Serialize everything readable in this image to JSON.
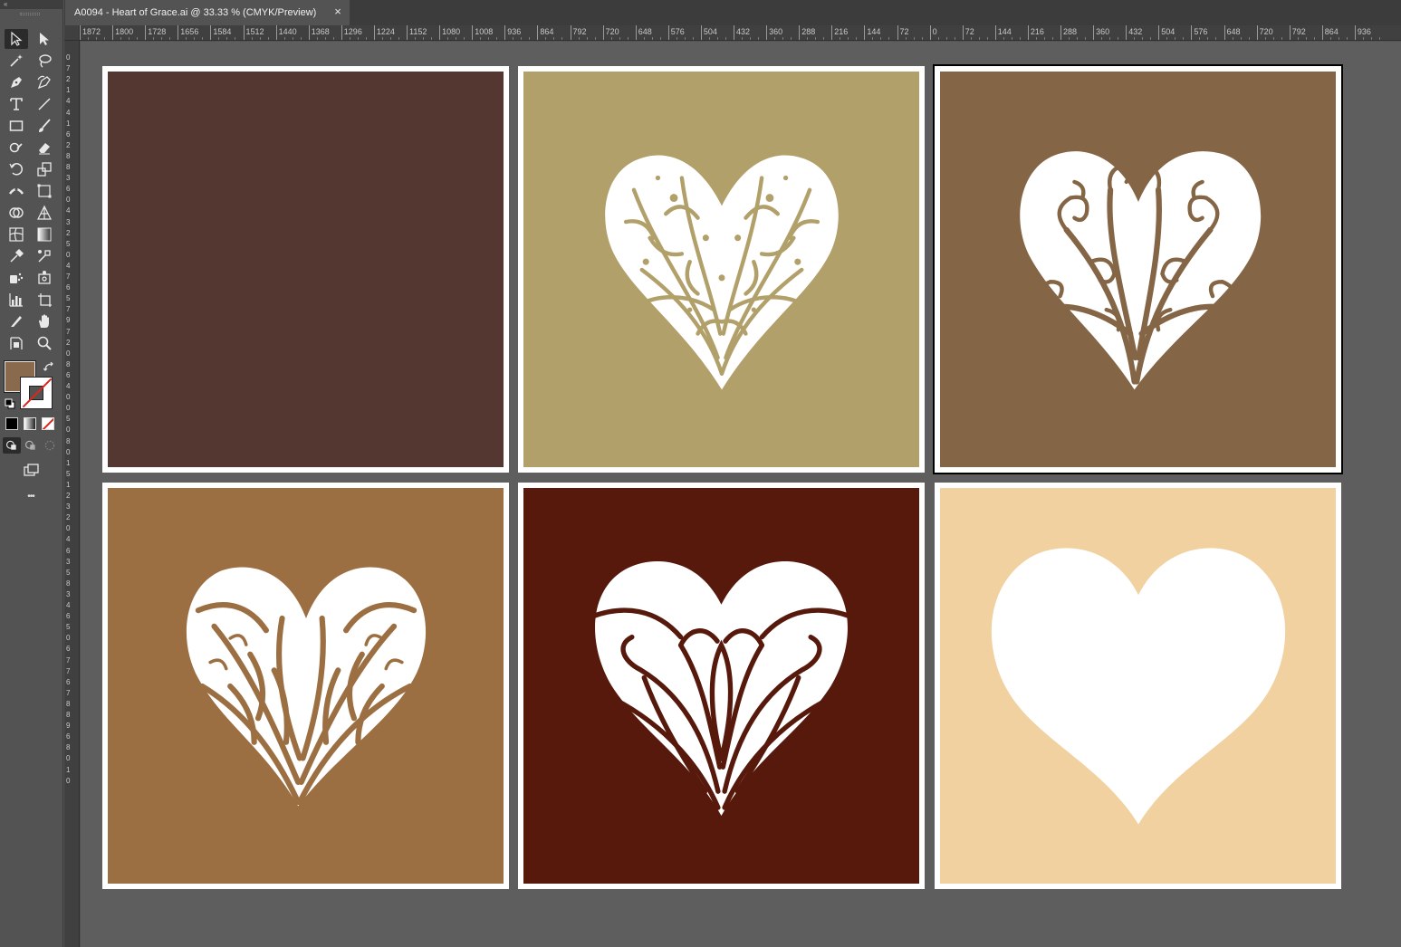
{
  "document_tab": {
    "title": "A0094 - Heart of Grace.ai @ 33.33 % (CMYK/Preview)",
    "close_glyph": "×"
  },
  "toolbar": {
    "collapse_glyph": "«",
    "more_glyph": "•••",
    "fill_color": "#8a6a4c",
    "stroke_color": "none",
    "tools": [
      "selection-tool",
      "direct-selection-tool",
      "magic-wand-tool",
      "lasso-tool",
      "pen-tool",
      "curvature-tool",
      "type-tool",
      "line-segment-tool",
      "rectangle-tool",
      "paintbrush-tool",
      "shaper-tool",
      "eraser-tool",
      "rotate-tool",
      "scale-tool",
      "width-tool",
      "free-transform-tool",
      "shape-builder-tool",
      "perspective-grid-tool",
      "mesh-tool",
      "gradient-tool",
      "eyedropper-tool",
      "blend-tool",
      "symbol-sprayer-tool",
      "column-graph-tool",
      "artboard-tool",
      "slice-tool",
      "hand-tool",
      "zoom-tool"
    ]
  },
  "rulers": {
    "horizontal_labels": [
      "1872",
      "1800",
      "1728",
      "1656",
      "1584",
      "1512",
      "1440",
      "1368",
      "1296",
      "1224",
      "1152",
      "1080",
      "1008",
      "936",
      "864",
      "792",
      "720",
      "648",
      "576",
      "504",
      "432",
      "360",
      "288",
      "216",
      "144",
      "72",
      "0",
      "72",
      "144",
      "216",
      "288",
      "360",
      "432",
      "504",
      "576",
      "648",
      "720",
      "792",
      "864",
      "936"
    ],
    "vertical_digits": [
      "0",
      "7",
      "2",
      "1",
      "4",
      "4",
      "1",
      "6",
      "2",
      "8",
      "8",
      "3",
      "6",
      "0",
      "4",
      "3",
      "2",
      "5",
      "0",
      "4",
      "7",
      "6",
      "5",
      "7",
      "9",
      "7",
      "2",
      "0",
      "8",
      "6",
      "4",
      "0",
      "0",
      "5",
      "0",
      "8",
      "0",
      "1",
      "5",
      "1",
      "2",
      "3",
      "2",
      "0",
      "4",
      "6",
      "3",
      "5",
      "8",
      "3",
      "4",
      "6",
      "5",
      "0",
      "6",
      "7",
      "7",
      "6",
      "7",
      "8",
      "8",
      "9",
      "6",
      "8",
      "0",
      "1",
      "0"
    ]
  },
  "artboards": [
    {
      "name": "artboard-1",
      "background": "#533730",
      "heart": "none",
      "selected": false
    },
    {
      "name": "artboard-2",
      "background": "#b2a06a",
      "heart": "filigree-fine",
      "selected": false
    },
    {
      "name": "artboard-3",
      "background": "#846545",
      "heart": "filigree-swirl",
      "selected": true
    },
    {
      "name": "artboard-4",
      "background": "#9c6f43",
      "heart": "petal-ornate",
      "selected": false
    },
    {
      "name": "artboard-5",
      "background": "#56190c",
      "heart": "petal-bold",
      "selected": false
    },
    {
      "name": "artboard-6",
      "background": "#f0d19f",
      "heart": "solid",
      "selected": false
    }
  ],
  "colors": {
    "ui_background": "#535353",
    "canvas": "#5e5e5e",
    "ruler": "#404040",
    "heart_fill": "#ffffff"
  }
}
